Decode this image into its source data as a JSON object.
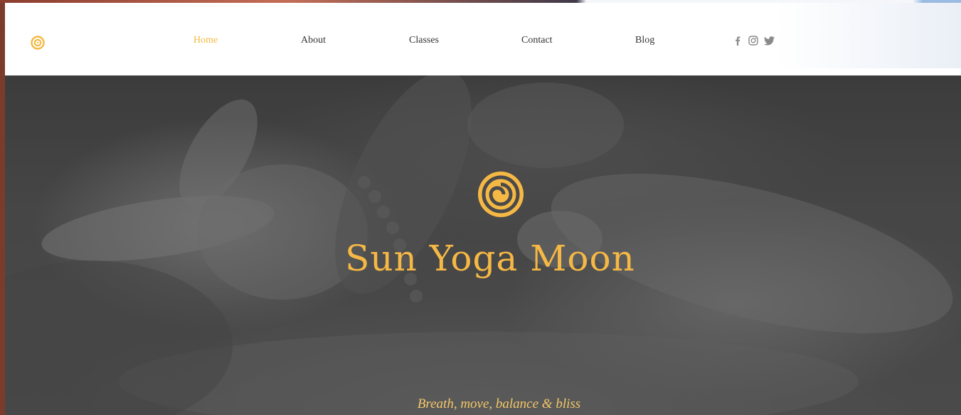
{
  "header": {
    "nav": [
      {
        "id": "home",
        "label": "Home",
        "active": true
      },
      {
        "id": "about",
        "label": "About",
        "active": false
      },
      {
        "id": "classes",
        "label": "Classes",
        "active": false
      },
      {
        "id": "contact",
        "label": "Contact",
        "active": false
      },
      {
        "id": "blog",
        "label": "Blog",
        "active": false
      }
    ],
    "social_icons": [
      "facebook-icon",
      "instagram-icon",
      "twitter-icon"
    ]
  },
  "hero": {
    "title": "Sun Yoga Moon",
    "tagline": "Breath, move, balance & bliss",
    "logo_icon": "sun-moon-spiral-icon"
  },
  "colors": {
    "accent": "#f4b942",
    "nav_text": "#333333",
    "social_icon": "#8a8a8a",
    "hero_overlay": "#454545"
  }
}
